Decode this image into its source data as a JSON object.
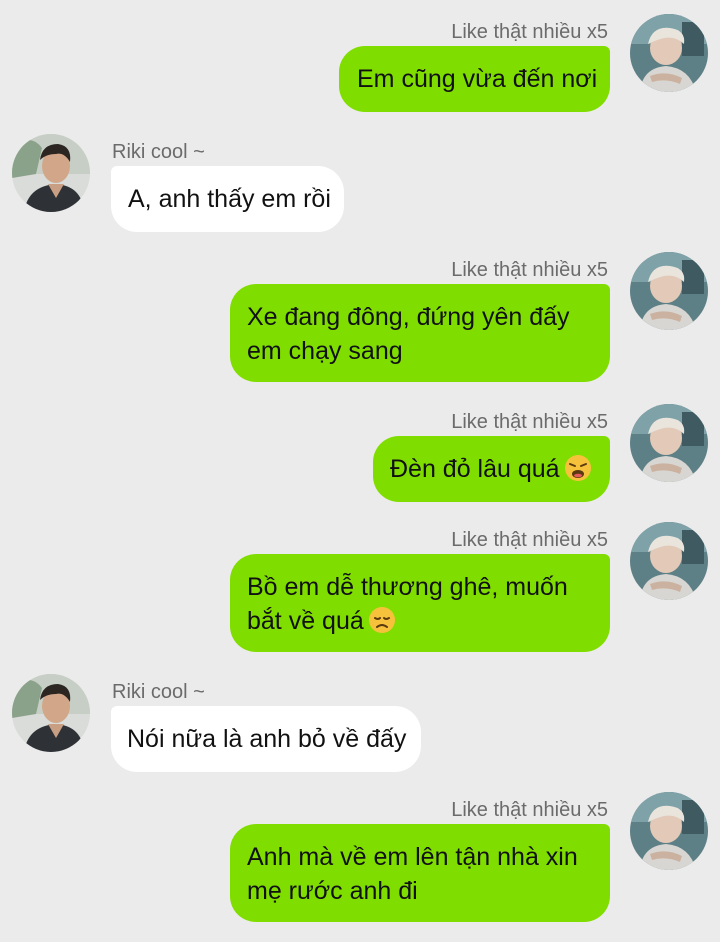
{
  "contacts": {
    "me": {
      "name": "Like thật nhiều x5",
      "avatar_icon": "avatar-icon"
    },
    "other": {
      "name": "Riki cool ~",
      "avatar_icon": "avatar-icon"
    }
  },
  "messages": [
    {
      "sender": "me",
      "lines": [
        "Em cũng vừa đến nơi"
      ]
    },
    {
      "sender": "other",
      "lines": [
        "A, anh thấy em rồi"
      ]
    },
    {
      "sender": "me",
      "lines": [
        "Xe đang đông, đứng yên đấy",
        "em chạy sang"
      ]
    },
    {
      "sender": "me",
      "lines": [
        "Đèn đỏ lâu quá"
      ],
      "emoji": "weary-face-emoji"
    },
    {
      "sender": "me",
      "lines": [
        "Bồ em dễ thương ghê, muốn",
        "bắt về quá"
      ],
      "emoji": "disappointed-face-emoji"
    },
    {
      "sender": "other",
      "lines": [
        "Nói nữa là anh bỏ về đấy"
      ]
    },
    {
      "sender": "me",
      "lines": [
        "Anh mà về em lên tận nhà xin",
        "mẹ rước anh đi"
      ]
    }
  ],
  "colors": {
    "background": "#ebebeb",
    "my_bubble": "#80dd00",
    "their_bubble": "#ffffff",
    "name_text": "#6b6b6b",
    "message_text": "#111111"
  }
}
